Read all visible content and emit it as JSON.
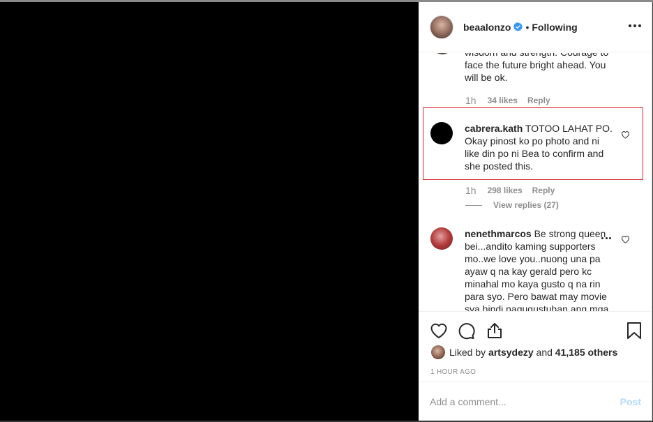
{
  "post": {
    "username": "beaalonzo",
    "separator": "•",
    "follow_state": "Following"
  },
  "comments": [
    {
      "text": "wisdom and strength. Courage to face the future bright ahead. You will be ok.",
      "time": "1h",
      "likes": "34 likes",
      "reply": "Reply"
    },
    {
      "username": "cabrera.kath",
      "text": " TOTOO LAHAT PO. Okay pinost ko po photo and ni like din po ni Bea to confirm and she posted this.",
      "time": "1h",
      "likes": "298 likes",
      "reply": "Reply",
      "view_replies": "View replies (27)"
    },
    {
      "username": "nenethmarcos",
      "text": " Be strong queen bei...andito kaming supporters mo..we love you..nuong una pa ayaw q na kay gerald pero kc minahal mo kaya gusto q na rin para syo. Pero bawat may movie sya hindi nagugustuhan ang mga"
    }
  ],
  "likes": {
    "prefix": "Liked by ",
    "user": "artsydezy",
    "and": " and ",
    "others": "41,185 others"
  },
  "time_ago": "1 HOUR AGO",
  "comment_form": {
    "placeholder": "Add a comment...",
    "post_label": "Post"
  },
  "colors": {
    "highlight_border": "#d9242c",
    "verified_badge": "#3897f0",
    "post_disabled": "#b3dbff"
  }
}
